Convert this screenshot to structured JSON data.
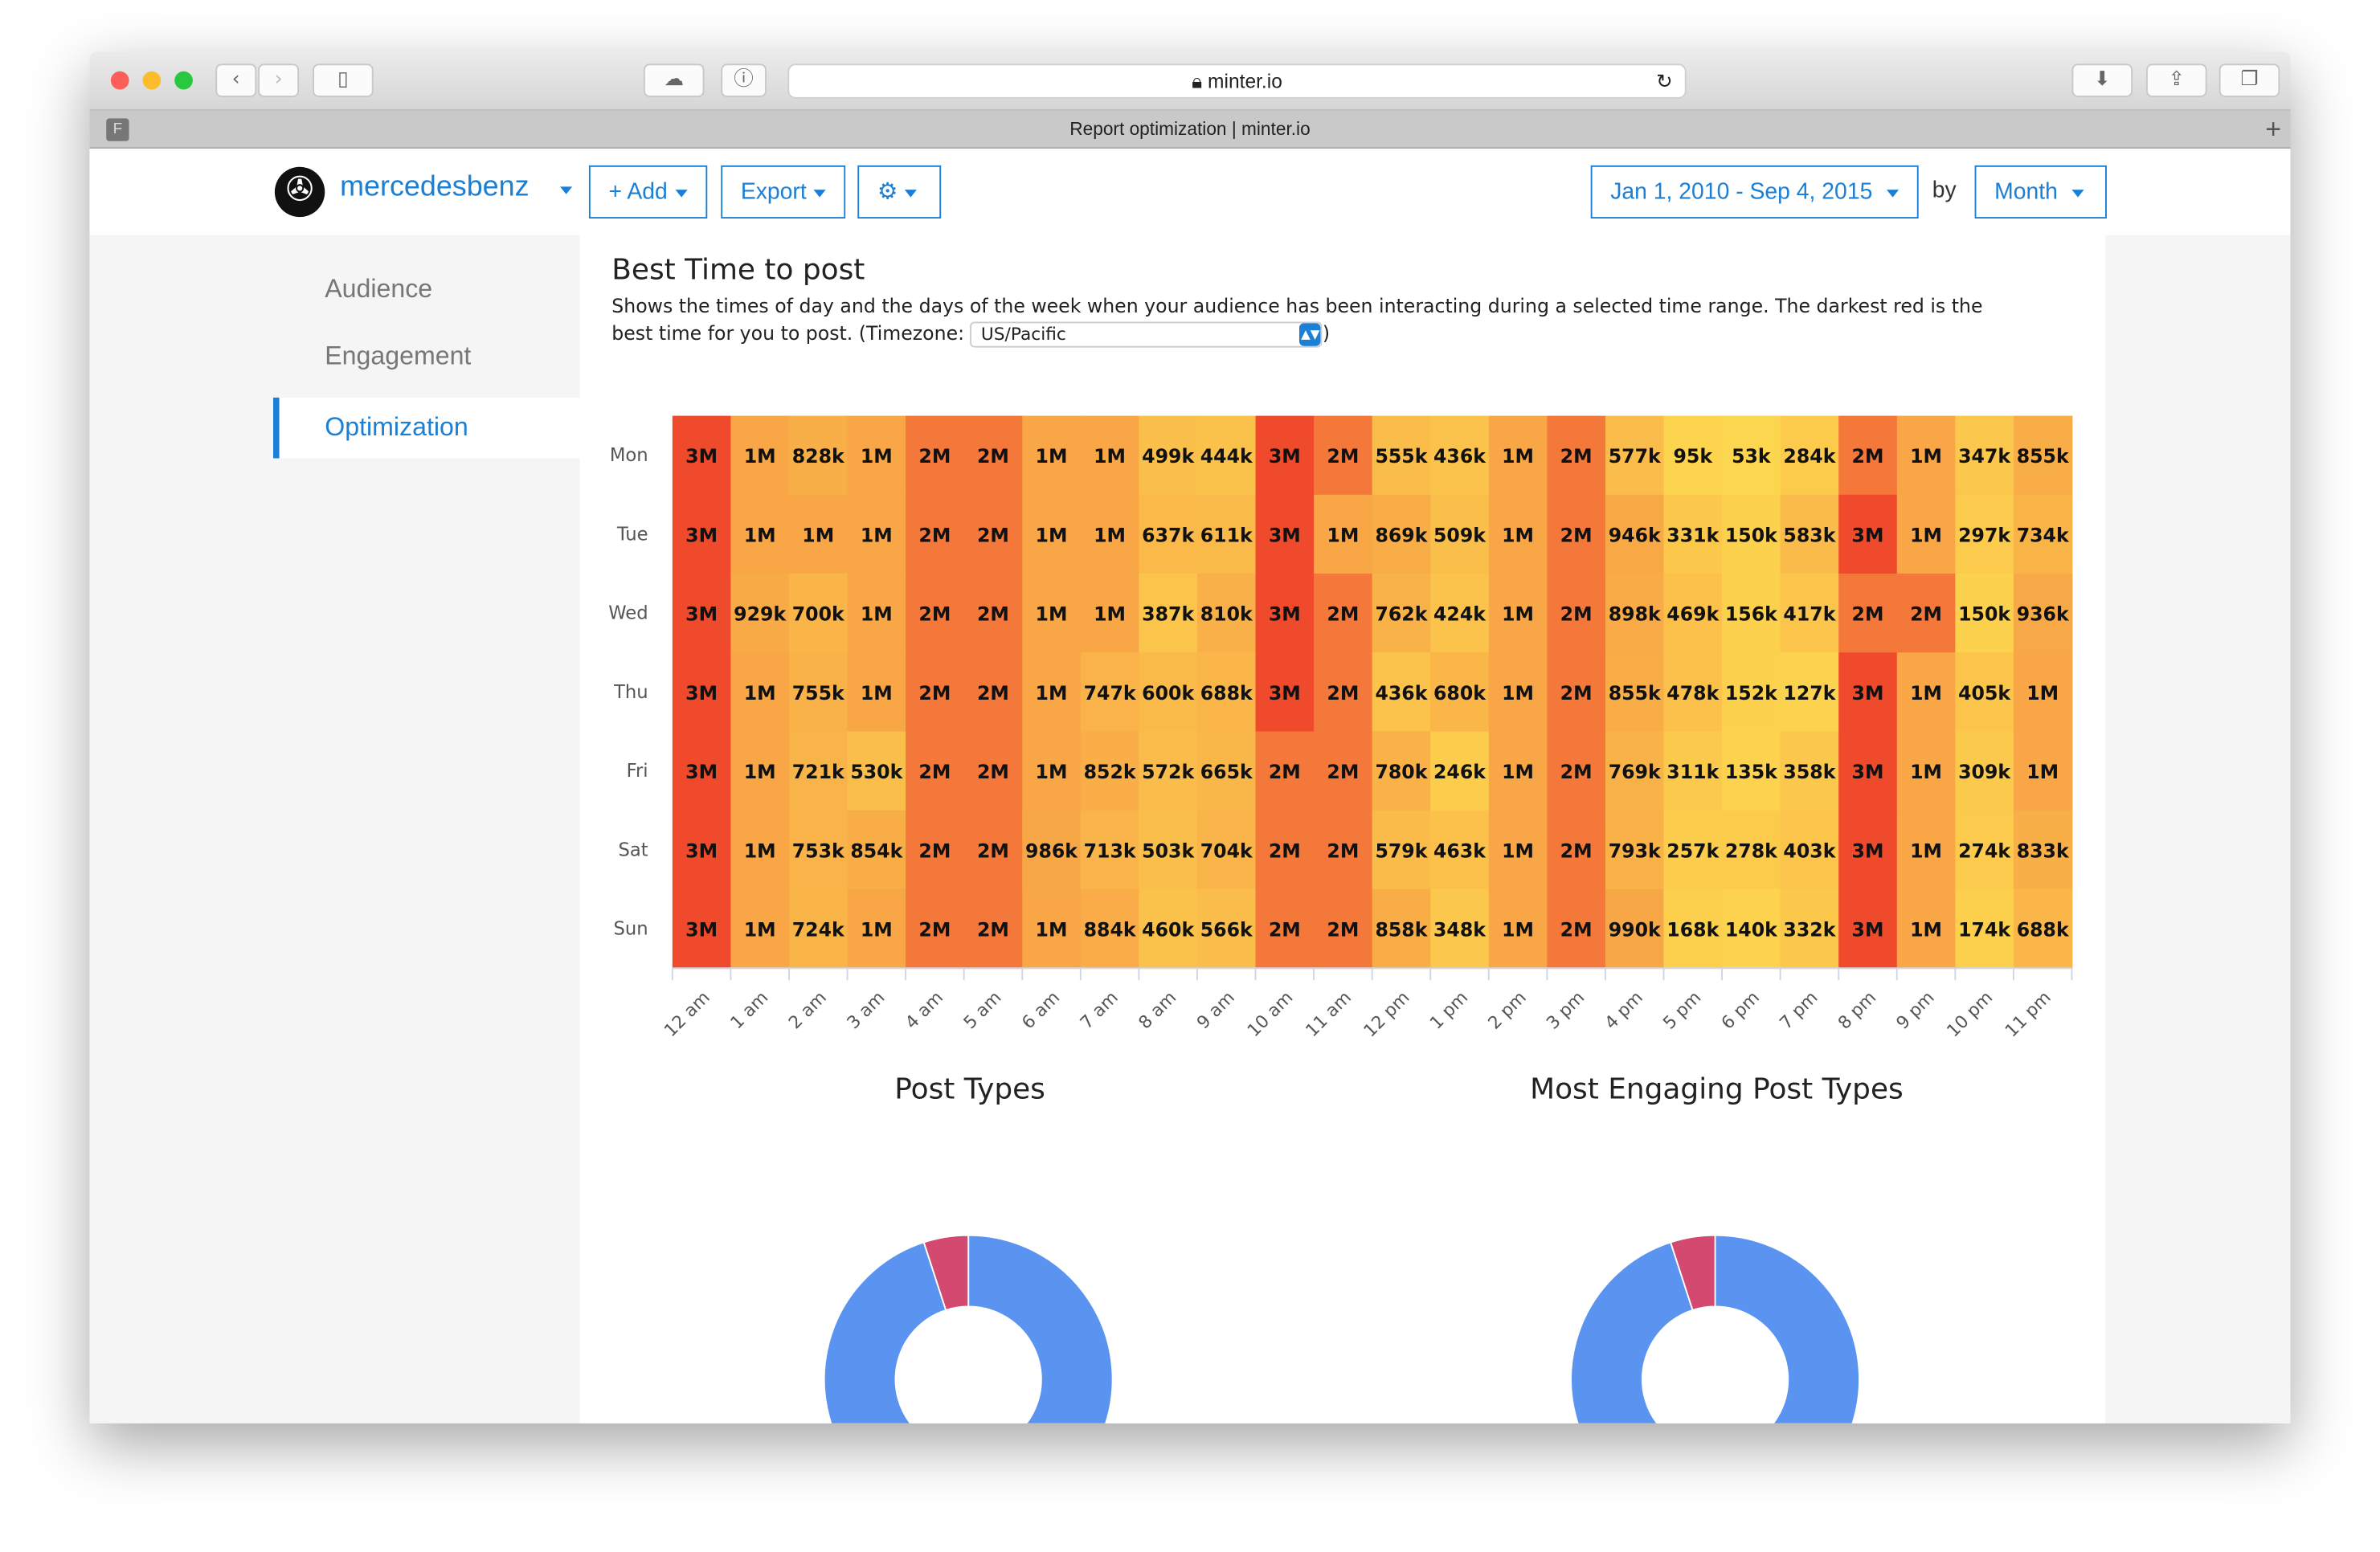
{
  "browser": {
    "url": "minter.io",
    "tab_title": "Report optimization | minter.io"
  },
  "header": {
    "account": "mercedesbenz",
    "add_label": "+ Add",
    "export_label": "Export",
    "date_range": "Jan 1, 2010 - Sep 4, 2015",
    "by_label": "by",
    "period": "Month",
    "accent": "#1b7fd6"
  },
  "sidebar": {
    "items": [
      {
        "label": "Audience"
      },
      {
        "label": "Engagement"
      },
      {
        "label": "Optimization",
        "active": true
      }
    ]
  },
  "main": {
    "title": "Best Time to post",
    "description": "Shows the times of day and the days of the week when your audience has been interacting during a selected time range. The darkest red is the best time for you to post. (Timezone:",
    "description_end": ")",
    "timezone": "US/Pacific"
  },
  "chart_data": [
    {
      "type": "heatmap",
      "rows": [
        "Mon",
        "Tue",
        "Wed",
        "Thu",
        "Fri",
        "Sat",
        "Sun"
      ],
      "columns": [
        "12 am",
        "1 am",
        "2 am",
        "3 am",
        "4 am",
        "5 am",
        "6 am",
        "7 am",
        "8 am",
        "9 am",
        "10 am",
        "11 am",
        "12 pm",
        "1 pm",
        "2 pm",
        "3 pm",
        "4 pm",
        "5 pm",
        "6 pm",
        "7 pm",
        "8 pm",
        "9 pm",
        "10 pm",
        "11 pm"
      ],
      "values": [
        [
          "3M",
          "1M",
          "828k",
          "1M",
          "2M",
          "2M",
          "1M",
          "1M",
          "499k",
          "444k",
          "3M",
          "2M",
          "555k",
          "436k",
          "1M",
          "2M",
          "577k",
          "95k",
          "53k",
          "284k",
          "2M",
          "1M",
          "347k",
          "855k"
        ],
        [
          "3M",
          "1M",
          "1M",
          "1M",
          "2M",
          "2M",
          "1M",
          "1M",
          "637k",
          "611k",
          "3M",
          "1M",
          "869k",
          "509k",
          "1M",
          "2M",
          "946k",
          "331k",
          "150k",
          "583k",
          "3M",
          "1M",
          "297k",
          "734k"
        ],
        [
          "3M",
          "929k",
          "700k",
          "1M",
          "2M",
          "2M",
          "1M",
          "1M",
          "387k",
          "810k",
          "3M",
          "2M",
          "762k",
          "424k",
          "1M",
          "2M",
          "898k",
          "469k",
          "156k",
          "417k",
          "2M",
          "2M",
          "150k",
          "936k"
        ],
        [
          "3M",
          "1M",
          "755k",
          "1M",
          "2M",
          "2M",
          "1M",
          "747k",
          "600k",
          "688k",
          "3M",
          "2M",
          "436k",
          "680k",
          "1M",
          "2M",
          "855k",
          "478k",
          "152k",
          "127k",
          "3M",
          "1M",
          "405k",
          "1M"
        ],
        [
          "3M",
          "1M",
          "721k",
          "530k",
          "2M",
          "2M",
          "1M",
          "852k",
          "572k",
          "665k",
          "2M",
          "2M",
          "780k",
          "246k",
          "1M",
          "2M",
          "769k",
          "311k",
          "135k",
          "358k",
          "3M",
          "1M",
          "309k",
          "1M"
        ],
        [
          "3M",
          "1M",
          "753k",
          "854k",
          "2M",
          "2M",
          "986k",
          "713k",
          "503k",
          "704k",
          "2M",
          "2M",
          "579k",
          "463k",
          "1M",
          "2M",
          "793k",
          "257k",
          "278k",
          "403k",
          "3M",
          "1M",
          "274k",
          "833k"
        ],
        [
          "3M",
          "1M",
          "724k",
          "1M",
          "2M",
          "2M",
          "1M",
          "884k",
          "460k",
          "566k",
          "2M",
          "2M",
          "858k",
          "348k",
          "1M",
          "2M",
          "990k",
          "168k",
          "140k",
          "332k",
          "3M",
          "1M",
          "174k",
          "688k"
        ]
      ],
      "color_scale": [
        "#fdd94f",
        "#f8a646",
        "#ef4a2b"
      ]
    },
    {
      "type": "pie",
      "title": "Post Types",
      "donut": true,
      "slices": [
        {
          "value": 95,
          "color": "#5a94f0"
        },
        {
          "value": 5,
          "color": "#d4496f"
        }
      ]
    },
    {
      "type": "pie",
      "title": "Most Engaging Post Types",
      "donut": true,
      "slices": [
        {
          "value": 95,
          "color": "#5a94f0"
        },
        {
          "value": 5,
          "color": "#d4496f"
        }
      ]
    }
  ]
}
